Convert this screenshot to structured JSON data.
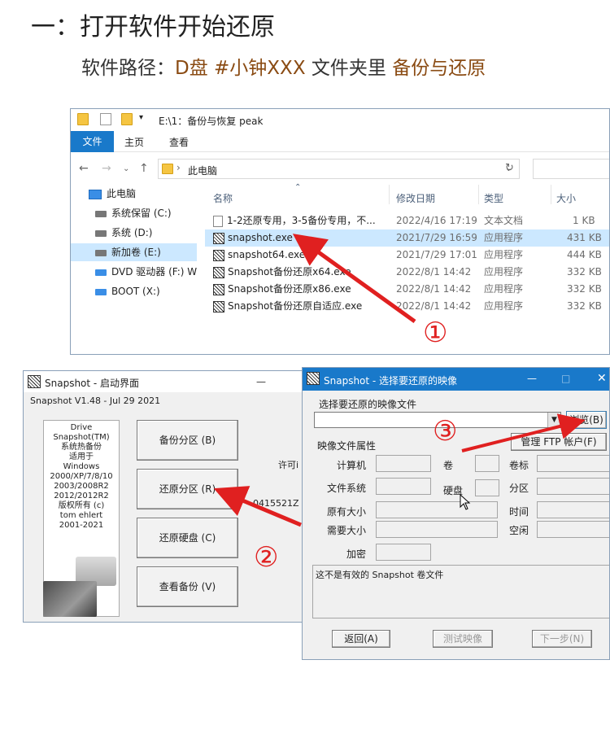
{
  "heading": "一：打开软件开始还原",
  "subline": {
    "prefix": "软件路径：",
    "drive": "D盘",
    "tag": "#小钟XXX",
    "mid": "文件夹里",
    "folder": "备份与还原"
  },
  "explorer": {
    "title": "E:\\1：备份与恢复 peak",
    "ribbon_tabs": [
      "文件",
      "主页",
      "查看"
    ],
    "address": "此电脑",
    "tree": [
      "此电脑",
      "系统保留 (C:)",
      "系统 (D:)",
      "新加卷 (E:)",
      "DVD 驱动器 (F:) W",
      "BOOT (X:)"
    ],
    "columns": [
      "名称",
      "修改日期",
      "类型",
      "大小"
    ],
    "files": [
      {
        "name": "1-2还原专用，3-5备份专用，不...",
        "date": "2022/4/16 17:19",
        "type": "文本文档",
        "size": "1 KB",
        "icon": "text-file-icon"
      },
      {
        "name": "snapshot.exe",
        "date": "2021/7/29 16:59",
        "type": "应用程序",
        "size": "431 KB",
        "icon": "exe-icon",
        "selected": true
      },
      {
        "name": "snapshot64.exe",
        "date": "2021/7/29 17:01",
        "type": "应用程序",
        "size": "444 KB",
        "icon": "exe-icon"
      },
      {
        "name": "Snapshot备份还原x64.exe",
        "date": "2022/8/1 14:42",
        "type": "应用程序",
        "size": "332 KB",
        "icon": "exe-icon"
      },
      {
        "name": "Snapshot备份还原x86.exe",
        "date": "2022/8/1 14:42",
        "type": "应用程序",
        "size": "332 KB",
        "icon": "exe-icon"
      },
      {
        "name": "Snapshot备份还原自适应.exe",
        "date": "2022/8/1 14:42",
        "type": "应用程序",
        "size": "332 KB",
        "icon": "exe-icon"
      }
    ]
  },
  "snap_start": {
    "title": "Snapshot - 启动界面",
    "minimize": "—",
    "version": "Snapshot V1.48 - Jul 29 2021",
    "info_lines": [
      "Drive",
      "Snapshot(TM)",
      "系统热备份",
      "适用于",
      "Windows",
      "2000/XP/7/8/10",
      "2003/2008R2",
      "2012/2012R2",
      "版权所有 (c)",
      "tom ehlert",
      "2001-2021"
    ],
    "buttons": [
      "备份分区 (B)",
      "还原分区 (R)",
      "还原硬盘 (C)",
      "查看备份 (V)"
    ],
    "side_text": [
      "许可i",
      "0415521Z -"
    ]
  },
  "snap_select": {
    "title": "Snapshot - 选择要还原的映像",
    "controls": [
      "—",
      "□",
      "✕"
    ],
    "choose_label": "选择要还原的映像文件",
    "path_value": "",
    "browse": "浏览(B)",
    "ftp": "管理 FTP 帐户(F)",
    "props_label": "映像文件属性",
    "labels": [
      "计算机",
      "卷",
      "卷标",
      "文件系统",
      "硬盘",
      "分区",
      "原有大小",
      "时间",
      "需要大小",
      "空闲",
      "加密"
    ],
    "message": "这不是有效的 Snapshot 卷文件",
    "footer_buttons": [
      "返回(A)",
      "测试映像",
      "下一步(N)"
    ]
  },
  "markers": [
    "①",
    "②",
    "③"
  ],
  "colors": {
    "accent": "#1979ca",
    "arrow": "#e02020",
    "brown": "#8a4b13"
  }
}
